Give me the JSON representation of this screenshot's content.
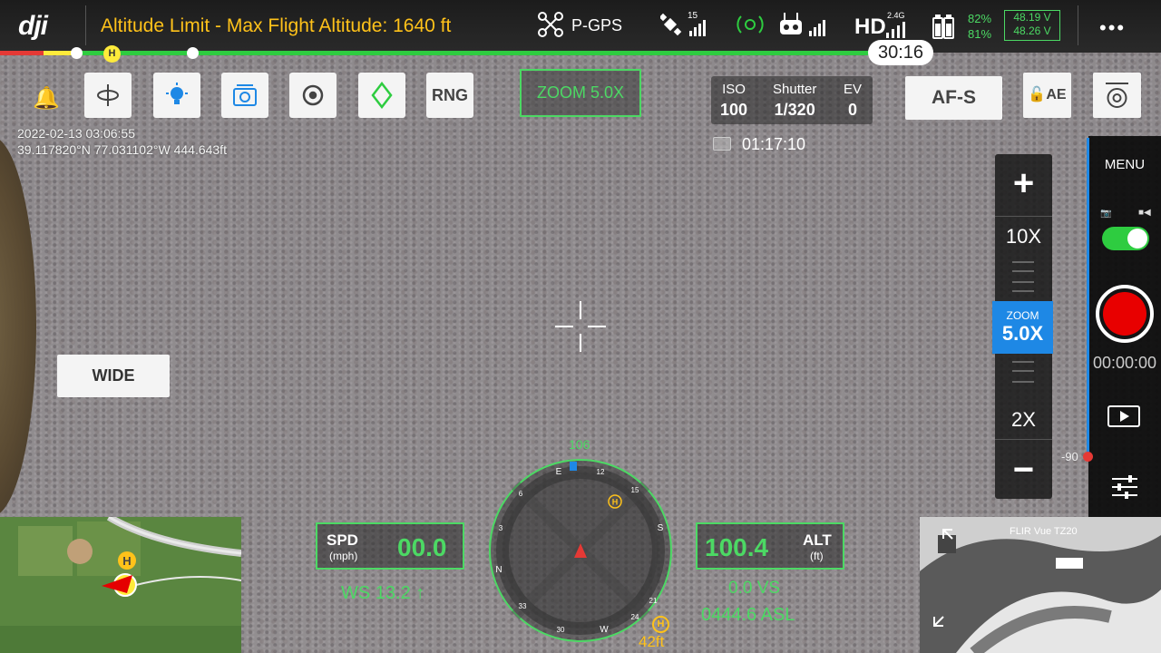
{
  "topbar": {
    "logo": "dji",
    "altitude_warning": "Altitude Limit - Max Flight Altitude: 1640 ft",
    "gps_mode": "P-GPS",
    "satellite_count": "15",
    "video_link": "HD",
    "video_band": "2.4G",
    "battery_percent_1": "82%",
    "battery_percent_2": "81%",
    "voltage_1": "48.19 V",
    "voltage_2": "48.26 V",
    "more": "•••"
  },
  "flight_bar": {
    "home_marker": "H",
    "flight_time_remaining": "30:16"
  },
  "toolbar": {
    "rng_label": "RNG",
    "zoom_indicator": "ZOOM  5.0X",
    "af_label": "AF-S",
    "ae_label": "AE"
  },
  "exposure": {
    "iso_label": "ISO",
    "iso_value": "100",
    "shutter_label": "Shutter",
    "shutter_value": "1/320",
    "ev_label": "EV",
    "ev_value": "0"
  },
  "recording": {
    "remaining_time": "01:17:10",
    "duration": "00:00:00"
  },
  "overlay": {
    "date_time": "2022-02-13 03:06:55",
    "coordinates": "39.117820°N 77.031102°W 444.643ft"
  },
  "zoom_slider": {
    "plus": "+",
    "level_10x": "10X",
    "current_label": "ZOOM",
    "current_value": "5.0X",
    "level_2x": "2X",
    "minus": "−"
  },
  "camera_panel": {
    "menu_label": "MENU",
    "gimbal_pitch": "-90"
  },
  "lens_button": {
    "label": "WIDE"
  },
  "telemetry": {
    "spd_label": "SPD",
    "spd_unit": "(mph)",
    "spd_value": "00.0",
    "wind": "WS 13.2 ↑",
    "alt_label": "ALT",
    "alt_unit": "(ft)",
    "alt_value": "100.4",
    "vs": "0.0  VS",
    "asl": "0444.6 ASL",
    "heading": "106",
    "home_distance": "42ft",
    "home_marker": "H"
  },
  "compass": {
    "cardinals": [
      "E",
      "S",
      "W",
      "N"
    ],
    "ticks": [
      "12",
      "15",
      "21",
      "24",
      "30",
      "33",
      "3",
      "6"
    ]
  },
  "minimap": {
    "home_marker": "H"
  },
  "thermal": {
    "label": "FLIR Vue TZ20"
  },
  "colors": {
    "accent_green": "#4cd964",
    "warning_yellow": "#ffc21a",
    "zoom_blue": "#1e88e5",
    "record_red": "#e80000"
  }
}
